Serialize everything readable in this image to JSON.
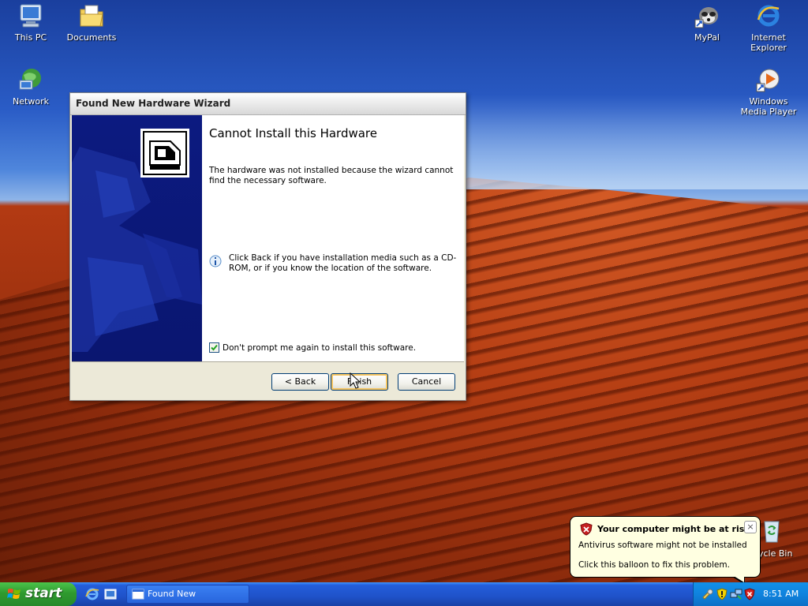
{
  "desktop": {
    "icons_left": [
      {
        "label": "This PC"
      },
      {
        "label": "Documents"
      },
      {
        "label": "Network"
      }
    ],
    "icons_right": [
      {
        "label": "MyPal"
      },
      {
        "label": "Internet Explorer"
      },
      {
        "label": "Windows Media Player"
      }
    ],
    "recycle_bin_label": "ycle Bin"
  },
  "dialog": {
    "title": "Found New Hardware Wizard",
    "heading": "Cannot Install this Hardware",
    "description": "The hardware was not installed because the wizard cannot find the necessary software.",
    "info_text": "Click Back if you have installation media such as a CD-ROM, or if you know the location of the software.",
    "checkbox_label": "Don't prompt me again to install this software.",
    "checkbox_checked": true,
    "buttons": {
      "back": "< Back",
      "finish": "Finish",
      "cancel": "Cancel"
    }
  },
  "balloon": {
    "title": "Your computer might be at risk",
    "line1": "Antivirus software might not be installed",
    "line2": "Click this balloon to fix this problem.",
    "close": "×"
  },
  "taskbar": {
    "start_label": "start",
    "task_button": "Found New Hardware...",
    "clock": "8:51 AM"
  },
  "colors": {
    "taskbar_blue": "#245edb",
    "start_green": "#2f9a2f",
    "banner_navy": "#0c1a80",
    "balloon_bg": "#ffffe1"
  }
}
